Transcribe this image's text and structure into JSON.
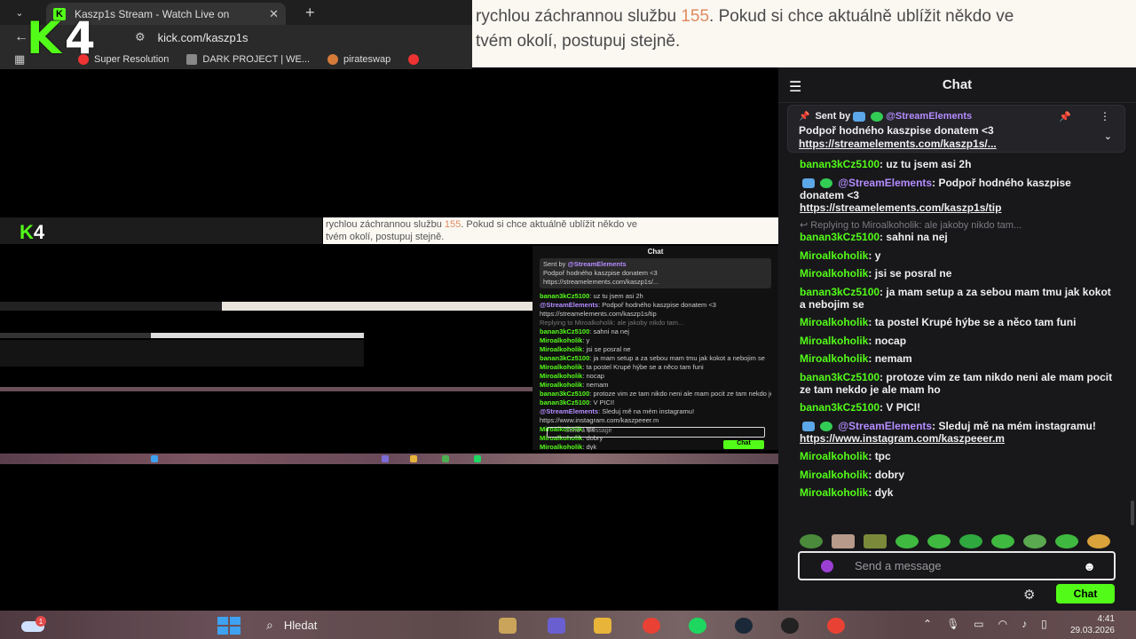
{
  "browser": {
    "tab_title": "Kaszp1s Stream - Watch Live on",
    "url": "kick.com/kaszp1s",
    "bookmarks": [
      "Super Resolution",
      "DARK PROJECT | WE...",
      "pirateswap"
    ],
    "overlay_logo": {
      "k": "K",
      "four": "4"
    }
  },
  "notice": {
    "line1_pre": "rychlou záchrannou službu ",
    "number": "155",
    "line1_post": ". Pokud si chce aktuálně ublížit někdo ve",
    "line2": "tvém okolí, postupuj stejně."
  },
  "nested": {
    "notice_pre": "rychlou záchrannou službu ",
    "notice_num": "155",
    "notice_post": ". Pokud si chce aktuálně ublížit někdo ve",
    "notice_line2": "tvém okolí, postupuj stejně.",
    "chat_title": "Chat",
    "input_placeholder": "Send a message",
    "send_label": "Chat"
  },
  "chat": {
    "title": "Chat",
    "pinned": {
      "sent_by": "Sent by",
      "author": "@StreamElements",
      "message": "Podpoř hodného kaszpise donatem <3",
      "link": "https://streamelements.com/kaszp1s/..."
    },
    "messages": [
      {
        "user": "banan3kCz5100",
        "text": "uz tu jsem asi 2h",
        "kind": "user"
      },
      {
        "user": "@StreamElements",
        "text": "Podpoř hodného kaszpise donatem <3",
        "link": "https://streamelements.com/kaszp1s/tip",
        "kind": "bot"
      },
      {
        "reply": "Replying to Miroalkoholik: ale jakoby nikdo tam...",
        "user": "banan3kCz5100",
        "text": "sahni na nej",
        "kind": "user"
      },
      {
        "user": "Miroalkoholik",
        "text": "y",
        "kind": "user"
      },
      {
        "user": "Miroalkoholik",
        "text": "jsi se posral ne",
        "kind": "user"
      },
      {
        "user": "banan3kCz5100",
        "text": "ja mam setup a za sebou mam tmu jak kokot a nebojim se",
        "kind": "user"
      },
      {
        "user": "Miroalkoholik",
        "text": "ta postel Krupé hýbe se a něco tam funi",
        "kind": "user"
      },
      {
        "user": "Miroalkoholik",
        "text": "nocap",
        "kind": "user"
      },
      {
        "user": "Miroalkoholik",
        "text": "nemam",
        "kind": "user"
      },
      {
        "user": "banan3kCz5100",
        "text": "protoze vim ze tam nikdo neni ale mam pocit ze tam nekdo je ale mam ho",
        "kind": "user"
      },
      {
        "user": "banan3kCz5100",
        "text": "V PICI!",
        "kind": "user"
      },
      {
        "user": "@StreamElements",
        "text": "Sleduj mě na mém instagramu!",
        "link": "https://www.instagram.com/kaszpeeer.m",
        "kind": "bot"
      },
      {
        "user": "Miroalkoholik",
        "text": "tpc",
        "kind": "user"
      },
      {
        "user": "Miroalkoholik",
        "text": "dobry",
        "kind": "user"
      },
      {
        "user": "Miroalkoholik",
        "text": "dyk",
        "kind": "user"
      }
    ],
    "input_placeholder": "Send a message",
    "send_label": "Chat"
  },
  "taskbar": {
    "weather_badge": "1",
    "search_label": "Hledat",
    "time": "4:41",
    "date": "29.03.2026"
  },
  "colors": {
    "kick_green": "#53fc18",
    "streamelements_purple": "#b48cff",
    "chat_bg": "#18181b",
    "notice_bg": "#fbf8f2",
    "notice_number": "#e08b62"
  }
}
